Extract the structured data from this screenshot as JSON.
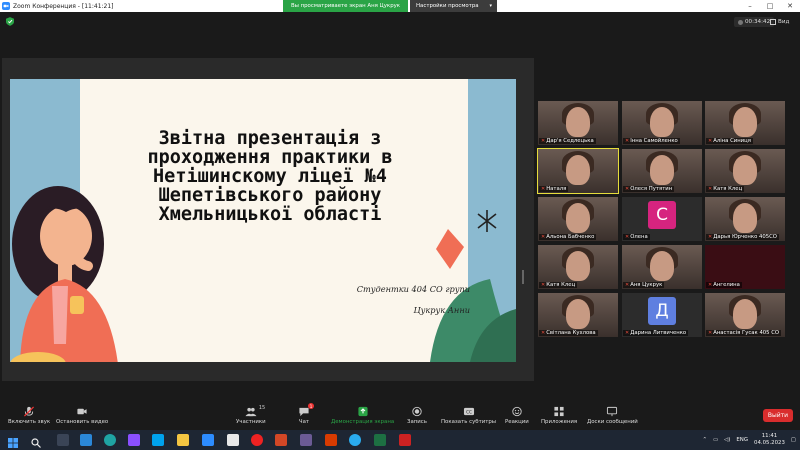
{
  "window": {
    "title": "Zoom Конференция - [11:41:21]",
    "share_banner": "Вы просматриваете экран Аня Цукрук",
    "view_settings": "Настройки просмотра"
  },
  "top": {
    "timer": "00:34:42",
    "view_label": "Вид"
  },
  "slide": {
    "title_lines": [
      "Звітна презентація з",
      "проходження практики в",
      "Нетішинскому ліцеї №4",
      "Шепетівського району",
      "Хмельницької області"
    ],
    "students": "Студентки 404 СО групи",
    "author": "Цукрук Анни"
  },
  "participants": [
    {
      "name": "Дар'я Седлецька",
      "type": "cam"
    },
    {
      "name": "Інна Самойленко",
      "type": "cam"
    },
    {
      "name": "Аліна Синиця",
      "type": "cam"
    },
    {
      "name": "Наталя",
      "type": "cam",
      "active": true
    },
    {
      "name": "Олеся Путятин",
      "type": "cam"
    },
    {
      "name": "Катя Клец",
      "type": "cam"
    },
    {
      "name": "Альона Бабченко",
      "type": "cam"
    },
    {
      "name": "Олена",
      "type": "avatar",
      "letter": "С",
      "color": "#d6247f"
    },
    {
      "name": "Дарья Юрченко 405СО",
      "type": "cam"
    },
    {
      "name": "Катя Клец",
      "type": "cam"
    },
    {
      "name": "Аня Цукрук",
      "type": "cam"
    },
    {
      "name": "Ангелина",
      "type": "dark"
    },
    {
      "name": "Світлана Кухлова",
      "type": "cam"
    },
    {
      "name": "Дарина Литвиченко",
      "type": "avatar",
      "letter": "Д",
      "color": "#5f7fe0"
    },
    {
      "name": "Анастасія Гусак 405 СО",
      "type": "cam"
    }
  ],
  "toolbar": {
    "mic_label": "Включить звук",
    "video_label": "Остановить видео",
    "participants_label": "Участники",
    "participants_count": "15",
    "chat_label": "Чат",
    "chat_badge": "1",
    "share_label": "Демонстрация экрана",
    "record_label": "Запись",
    "subtitles_label": "Показать субтитры",
    "reactions_label": "Реакции",
    "apps_label": "Приложения",
    "whiteboard_label": "Доски сообщений",
    "end_label": "Выйти"
  },
  "taskbar": {
    "language": "ENG",
    "time": "11:41",
    "date": "04.05.2023"
  },
  "colors": {
    "share_green": "#2aa446",
    "end_red": "#d92d2d",
    "slide_blue": "#8bbad0",
    "active_outline": "#e6dd3c"
  }
}
